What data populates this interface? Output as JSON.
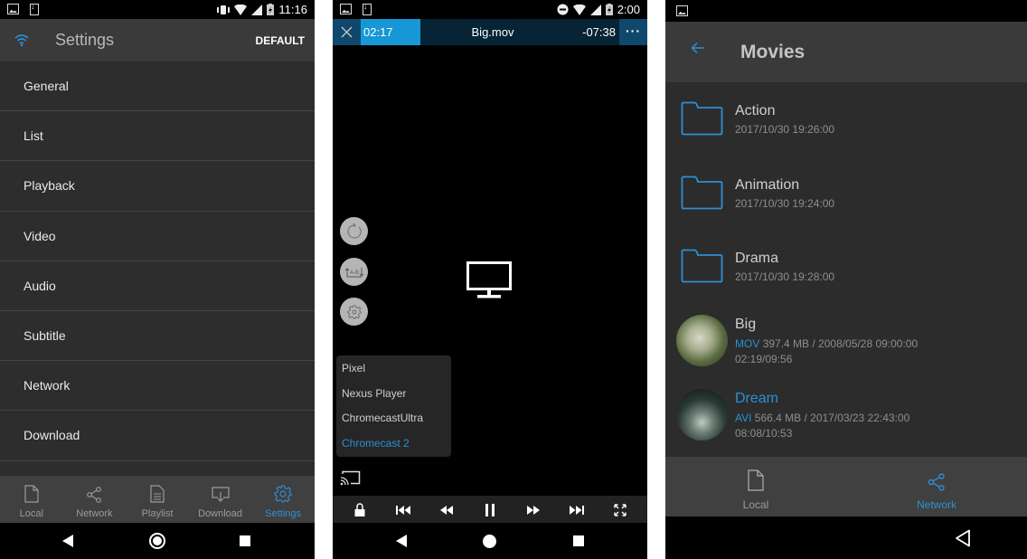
{
  "colors": {
    "accent": "#2d8fd5",
    "toolbar": "#3a3a3a",
    "background": "#2d2d2d",
    "player_bar": "#062435",
    "player_elapsed": "#1797d6"
  },
  "settings_screen": {
    "status": {
      "time": "11:16",
      "icons": [
        "image-icon",
        "download-icon",
        "vibrate-icon",
        "wifi-icon",
        "signal-icon",
        "battery-charging-icon"
      ]
    },
    "toolbar": {
      "icon": "wifi-icon",
      "title": "Settings",
      "action": "DEFAULT"
    },
    "items": [
      {
        "label": "General"
      },
      {
        "label": "List"
      },
      {
        "label": "Playback"
      },
      {
        "label": "Video"
      },
      {
        "label": "Audio"
      },
      {
        "label": "Subtitle"
      },
      {
        "label": "Network"
      },
      {
        "label": "Download"
      }
    ],
    "tabs": [
      {
        "label": "Local",
        "icon": "file-icon",
        "active": false
      },
      {
        "label": "Network",
        "icon": "share-icon",
        "active": false
      },
      {
        "label": "Playlist",
        "icon": "playlist-icon",
        "active": false
      },
      {
        "label": "Download",
        "icon": "download-icon",
        "active": false
      },
      {
        "label": "Settings",
        "icon": "gear-icon",
        "active": true
      }
    ]
  },
  "player_screen": {
    "status": {
      "time": "2:00",
      "icons": [
        "image-icon",
        "download-icon",
        "dnd-icon",
        "wifi-icon",
        "signal-icon",
        "battery-charging-icon"
      ]
    },
    "topbar": {
      "elapsed": "02:17",
      "title": "Big.mov",
      "remaining": "-07:38",
      "more": "···"
    },
    "side_buttons": [
      "rotate-icon",
      "ab-repeat-icon",
      "gear-icon"
    ],
    "center_icon": "monitor-icon",
    "cast_menu": {
      "devices": [
        "Pixel",
        "Nexus Player",
        "ChromecastUltra",
        "Chromecast 2"
      ],
      "selected": "Chromecast 2"
    },
    "controls": [
      "lock-icon",
      "skip-previous-icon",
      "rewind-icon",
      "pause-icon",
      "fast-forward-icon",
      "skip-next-icon",
      "fullscreen-icon"
    ]
  },
  "movies_screen": {
    "toolbar": {
      "title": "Movies"
    },
    "folders": [
      {
        "name": "Action",
        "date": "2017/10/30 19:26:00"
      },
      {
        "name": "Animation",
        "date": "2017/10/30 19:24:00"
      },
      {
        "name": "Drama",
        "date": "2017/10/30 19:28:00"
      }
    ],
    "videos": [
      {
        "name": "Big",
        "ext": "MOV",
        "info": "397.4 MB / 2008/05/28 09:00:00",
        "progress": "02:19/09:56",
        "playing": false
      },
      {
        "name": "Dream",
        "ext": "AVI",
        "info": "566.4 MB / 2017/03/23 22:43:00",
        "progress": "08:08/10:53",
        "playing": true
      }
    ],
    "tabs": [
      {
        "label": "Local",
        "icon": "file-icon",
        "active": false
      },
      {
        "label": "Network",
        "icon": "share-icon",
        "active": true
      }
    ]
  }
}
